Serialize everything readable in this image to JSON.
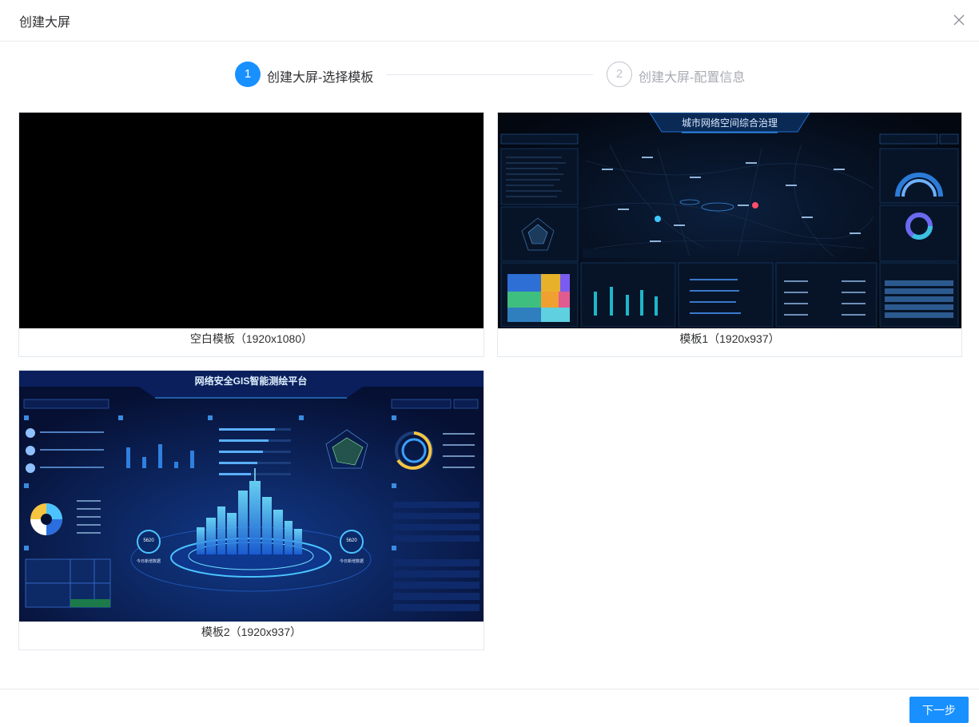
{
  "dialog": {
    "title": "创建大屏"
  },
  "steps": [
    {
      "number": "1",
      "label": "创建大屏-选择模板",
      "state": "active"
    },
    {
      "number": "2",
      "label": "创建大屏-配置信息",
      "state": "pending"
    }
  ],
  "templates": [
    {
      "caption": "空白模板（1920x1080）"
    },
    {
      "caption": "模板1（1920x937）",
      "preview_title": "城市网络空间综合治理"
    },
    {
      "caption": "模板2（1920x937）",
      "preview_title": "网络安全GIS智能测绘平台",
      "gauge_left": "5620",
      "gauge_left_label": "今日新增数据",
      "gauge_right": "5620",
      "gauge_right_label": "今日新增数据"
    }
  ],
  "footer": {
    "next_label": "下一步"
  },
  "colors": {
    "primary": "#1890ff",
    "border": "#e4e7ed",
    "text": "#303133",
    "muted": "#a8abb2"
  },
  "icons": {
    "close": "close-icon"
  }
}
